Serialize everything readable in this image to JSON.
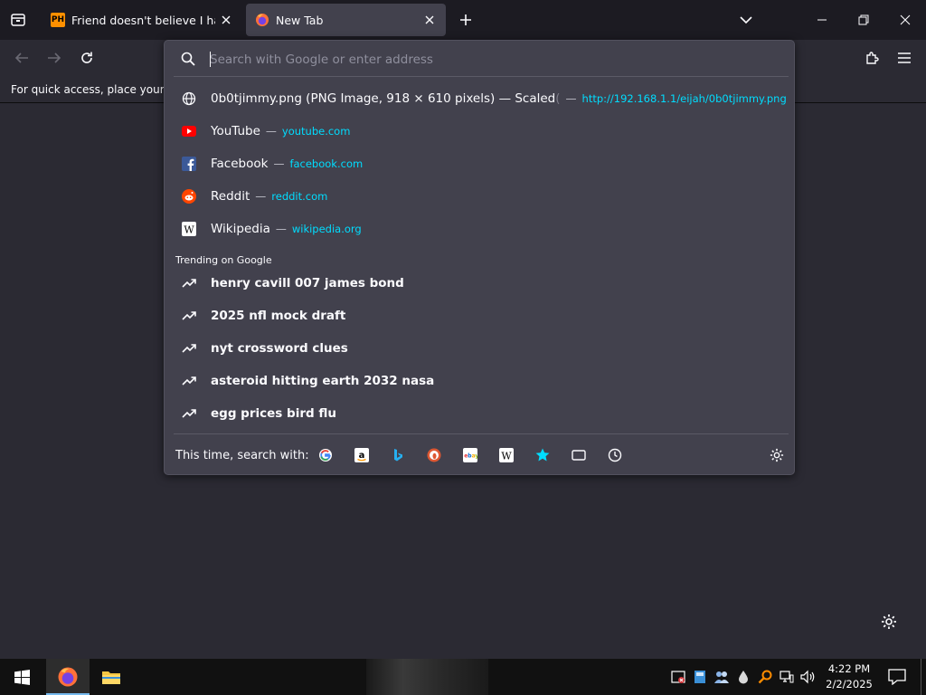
{
  "tabs": [
    {
      "title": "Friend doesn't believe I have a huge",
      "favicon": "PH",
      "active": false
    },
    {
      "title": "New Tab",
      "favicon": "firefox-icon",
      "active": true
    }
  ],
  "bookmarks_bar": {
    "hint": "For quick access, place your bookmarks here on the bookmarks toolbar."
  },
  "urlbar": {
    "placeholder": "Search with Google or enter address",
    "value": ""
  },
  "suggestions": [
    {
      "icon": "globe-icon",
      "title": "0b0tjimmy.png (PNG Image, 918 × 610 pixels) — Scaled",
      "title_faded": " (",
      "url": "http://192.168.1.1/eijah/0b0tjimmy.png"
    },
    {
      "icon": "youtube-icon",
      "title": "YouTube",
      "url": "youtube.com"
    },
    {
      "icon": "facebook-icon",
      "title": "Facebook",
      "url": "facebook.com"
    },
    {
      "icon": "reddit-icon",
      "title": "Reddit",
      "url": "reddit.com"
    },
    {
      "icon": "wikipedia-icon",
      "title": "Wikipedia",
      "url": "wikipedia.org"
    }
  ],
  "trending": {
    "label": "Trending on Google",
    "items": [
      "henry cavill 007 james bond",
      "2025 nfl mock draft",
      "nyt crossword clues",
      "asteroid hitting earth 2032 nasa",
      "egg prices bird flu"
    ]
  },
  "search_with": {
    "label": "This time, search with:",
    "engines": [
      "google-icon",
      "amazon-icon",
      "bing-icon",
      "duckduckgo-icon",
      "ebay-icon",
      "wikipedia-icon",
      "bookmarks-icon",
      "tabs-icon",
      "history-icon"
    ]
  },
  "taskbar": {
    "time": "4:22 PM",
    "date": "2/2/2025"
  },
  "colors": {
    "accent_url": "#00ddff",
    "popup_bg": "#42414d",
    "toolbar_bg": "#2b2a33",
    "tabstrip_bg": "#1c1b22"
  }
}
